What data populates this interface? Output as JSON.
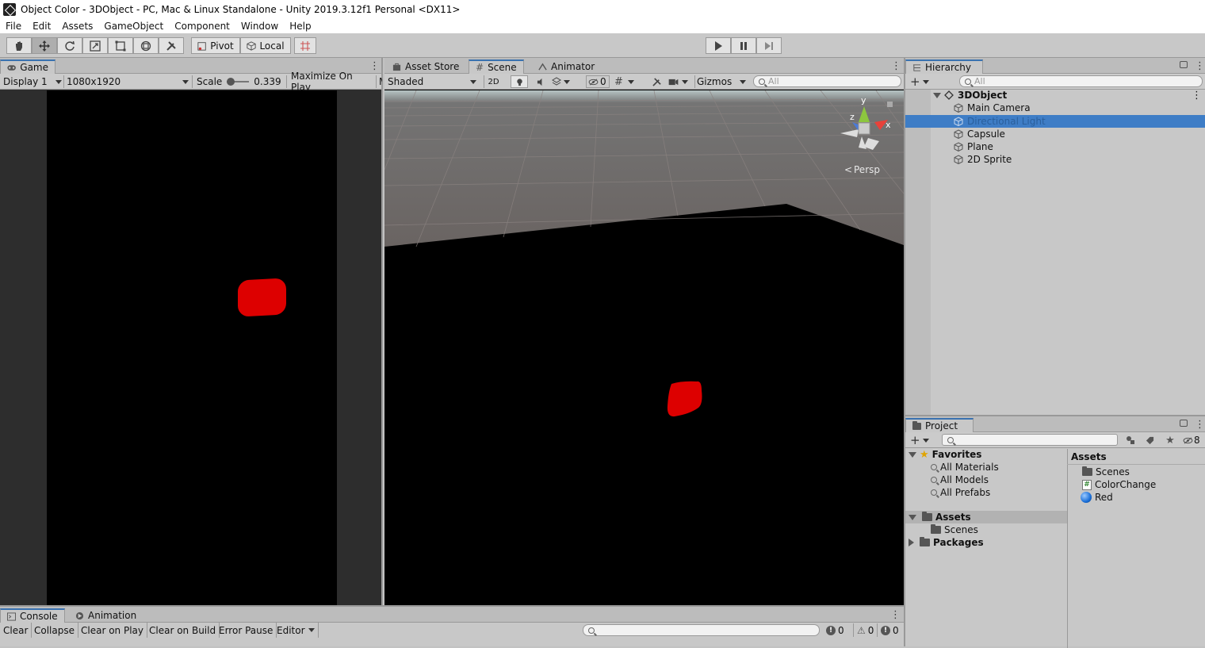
{
  "window": {
    "title": "Object Color - 3DObject - PC, Mac & Linux Standalone - Unity 2019.3.12f1 Personal <DX11>"
  },
  "menu": [
    "File",
    "Edit",
    "Assets",
    "GameObject",
    "Component",
    "Window",
    "Help"
  ],
  "toolbar": {
    "pivot_label": "Pivot",
    "local_label": "Local"
  },
  "game": {
    "tab_label": "Game",
    "display": "Display 1",
    "resolution": "1080x1920",
    "scale_label": "Scale",
    "scale_value": "0.339",
    "maximize_label": "Maximize On Play",
    "overflow_label": "M"
  },
  "scene": {
    "tabs": [
      "Asset Store",
      "Scene",
      "Animator"
    ],
    "shading_mode": "Shaded",
    "mode_2d": "2D",
    "hidden_count": "0",
    "gizmos_label": "Gizmos",
    "search_placeholder": "All",
    "persp_label": "Persp",
    "axis_y": "y",
    "axis_x": "x",
    "axis_z": "z"
  },
  "hierarchy": {
    "tab_label": "Hierarchy",
    "search_placeholder": "All",
    "scene_name": "3DObject",
    "items": [
      "Main Camera",
      "Directional Light",
      "Capsule",
      "Plane",
      "2D Sprite"
    ],
    "selected_index": 1
  },
  "project": {
    "tab_label": "Project",
    "hidden_count": "8",
    "favorites_label": "Favorites",
    "favorites": [
      "All Materials",
      "All Models",
      "All Prefabs"
    ],
    "assets_label": "Assets",
    "assets_children": [
      "Scenes"
    ],
    "packages_label": "Packages",
    "assets_panel_title": "Assets",
    "assets_items": [
      {
        "name": "Scenes",
        "icon": "folder-icon"
      },
      {
        "name": "ColorChange",
        "icon": "script-icon"
      },
      {
        "name": "Red",
        "icon": "material-icon"
      }
    ]
  },
  "console": {
    "tabs": [
      "Console",
      "Animation"
    ],
    "buttons": [
      "Clear",
      "Collapse",
      "Clear on Play",
      "Clear on Build",
      "Error Pause",
      "Editor"
    ],
    "info_count": "0",
    "warning_count": "0",
    "error_count": "0"
  },
  "colors": {
    "accent": "#3a72b0",
    "selection": "#3e7dc6",
    "object_red": "#dd0000"
  }
}
